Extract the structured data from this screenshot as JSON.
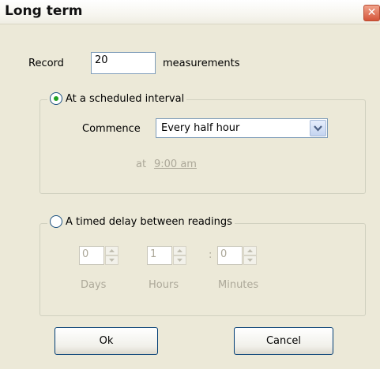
{
  "window": {
    "title": "Long term",
    "close_glyph": "✕"
  },
  "record": {
    "label_before": "Record",
    "value": "20",
    "label_after": "measurements"
  },
  "scheduled": {
    "option_label": "At a scheduled interval",
    "selected": true,
    "commence_label": "Commence",
    "commence_value": "Every half hour",
    "at_label": "at",
    "time_value": "9:00 am"
  },
  "delay": {
    "option_label": "A timed delay between readings",
    "selected": false,
    "days_value": "0",
    "hours_value": "1",
    "minutes_value": "0",
    "separator": ":",
    "days_label": "Days",
    "hours_label": "Hours",
    "minutes_label": "Minutes"
  },
  "buttons": {
    "ok_label": "Ok",
    "cancel_label": "Cancel"
  },
  "icons": {
    "close": "close-icon",
    "dropdown": "chevron-down-icon",
    "spin_up": "spin-up-icon",
    "spin_down": "spin-down-icon"
  },
  "colors": {
    "selected_radio": "#21a121",
    "disabled_text": "#aca899",
    "close_button": "#d4553a"
  }
}
